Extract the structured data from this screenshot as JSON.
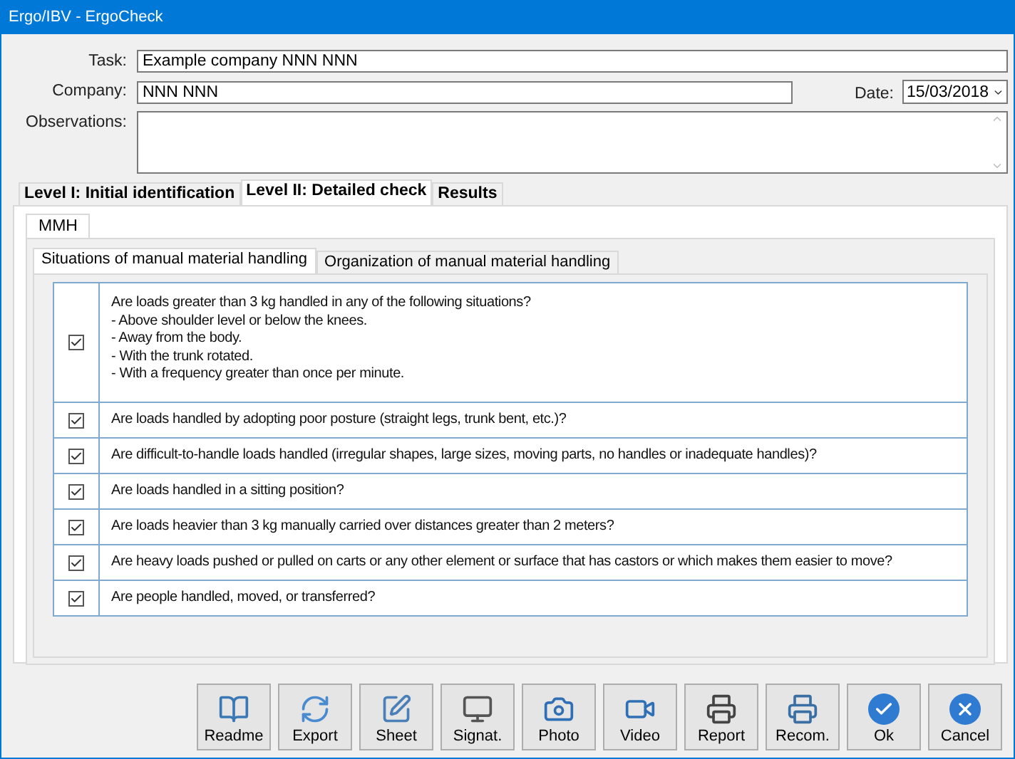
{
  "window": {
    "title": "Ergo/IBV - ErgoCheck"
  },
  "fields": {
    "task": {
      "label": "Task:",
      "value": "Example company NNN NNN"
    },
    "company": {
      "label": "Company:",
      "value": "NNN NNN"
    },
    "date": {
      "label": "Date:",
      "value": "15/03/2018"
    },
    "observations": {
      "label": "Observations:"
    }
  },
  "tabs": [
    {
      "label": "Level I: Initial identification",
      "selected": false
    },
    {
      "label": "Level II: Detailed check",
      "selected": true
    },
    {
      "label": "Results",
      "selected": false
    }
  ],
  "subtabs": [
    {
      "label": "MMH",
      "selected": true
    }
  ],
  "inner_tabs": [
    {
      "label": "Situations of manual material handling",
      "selected": true
    },
    {
      "label": "Organization of manual material handling",
      "selected": false
    }
  ],
  "questions": [
    {
      "text": "Are loads greater than 3 kg handled in any of the following situations?\n- Above shoulder level or below the knees.\n- Away from the body.\n- With the trunk rotated.\n- With a frequency greater than once per minute.",
      "checked": true
    },
    {
      "text": "Are loads handled by adopting poor posture (straight legs, trunk bent, etc.)?",
      "checked": true
    },
    {
      "text": "Are difficult-to-handle loads handled (irregular shapes, large sizes, moving parts, no handles or inadequate handles)?",
      "checked": true
    },
    {
      "text": "Are loads handled in a sitting position?",
      "checked": true
    },
    {
      "text": "Are loads heavier than 3 kg manually carried over distances greater than 2 meters?",
      "checked": true
    },
    {
      "text": "Are heavy loads pushed or pulled on carts or any other element or surface that has castors or which makes them easier to move?",
      "checked": true
    },
    {
      "text": "Are people handled, moved, or transferred?",
      "checked": true
    }
  ],
  "buttons": [
    {
      "label": "Readme",
      "kind": "readme"
    },
    {
      "label": "Export",
      "kind": "export"
    },
    {
      "label": "Sheet",
      "kind": "sheet"
    },
    {
      "label": "Signat.",
      "kind": "signature"
    },
    {
      "label": "Photo",
      "kind": "photo"
    },
    {
      "label": "Video",
      "kind": "video"
    },
    {
      "label": "Report",
      "kind": "report"
    },
    {
      "label": "Recom.",
      "kind": "recom"
    },
    {
      "label": "Ok",
      "kind": "ok"
    },
    {
      "label": "Cancel",
      "kind": "cancel"
    }
  ]
}
